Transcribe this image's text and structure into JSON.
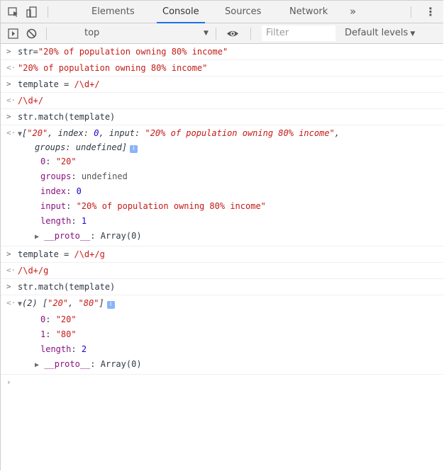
{
  "tabs": {
    "elements": "Elements",
    "console": "Console",
    "sources": "Sources",
    "network": "Network",
    "more": "»"
  },
  "toolbar": {
    "context": "top",
    "filter_placeholder": "Filter",
    "levels": "Default levels"
  },
  "console": {
    "in1": "str=\"20% of population owning 80% income\"",
    "out1": "\"20% of population owning 80% income\"",
    "in2": "template = /\\d+/",
    "out2": "/\\d+/",
    "in3": "str.match(template)",
    "out3": {
      "head_open": "[",
      "v0": "\"20\"",
      "sep1": ", ",
      "index_key": "index",
      "index_val": "0",
      "input_key": "input",
      "input_val": "\"20% of population owning 80% income\"",
      "tail": ",",
      "groups_line": "groups: undefined]",
      "p0_key": "0",
      "p0_val": "\"20\"",
      "groups_key": "groups",
      "groups_val": "undefined",
      "index_key2": "index",
      "index_val2": "0",
      "input_key2": "input",
      "input_val2": "\"20% of population owning 80% income\"",
      "length_key": "length",
      "length_val": "1",
      "proto_key": "__proto__",
      "proto_val": "Array(0)"
    },
    "in4": "template = /\\d+/g",
    "out4": "/\\d+/g",
    "in5": "str.match(template)",
    "out5": {
      "count": "(2)",
      "v0": "\"20\"",
      "v1": "\"80\"",
      "p0_key": "0",
      "p0_val": "\"20\"",
      "p1_key": "1",
      "p1_val": "\"80\"",
      "length_key": "length",
      "length_val": "2",
      "proto_key": "__proto__",
      "proto_val": "Array(0)"
    }
  },
  "colors": {
    "string": "#c41a16",
    "property": "#881280",
    "number": "#1c00cf",
    "accent": "#1a73e8"
  }
}
